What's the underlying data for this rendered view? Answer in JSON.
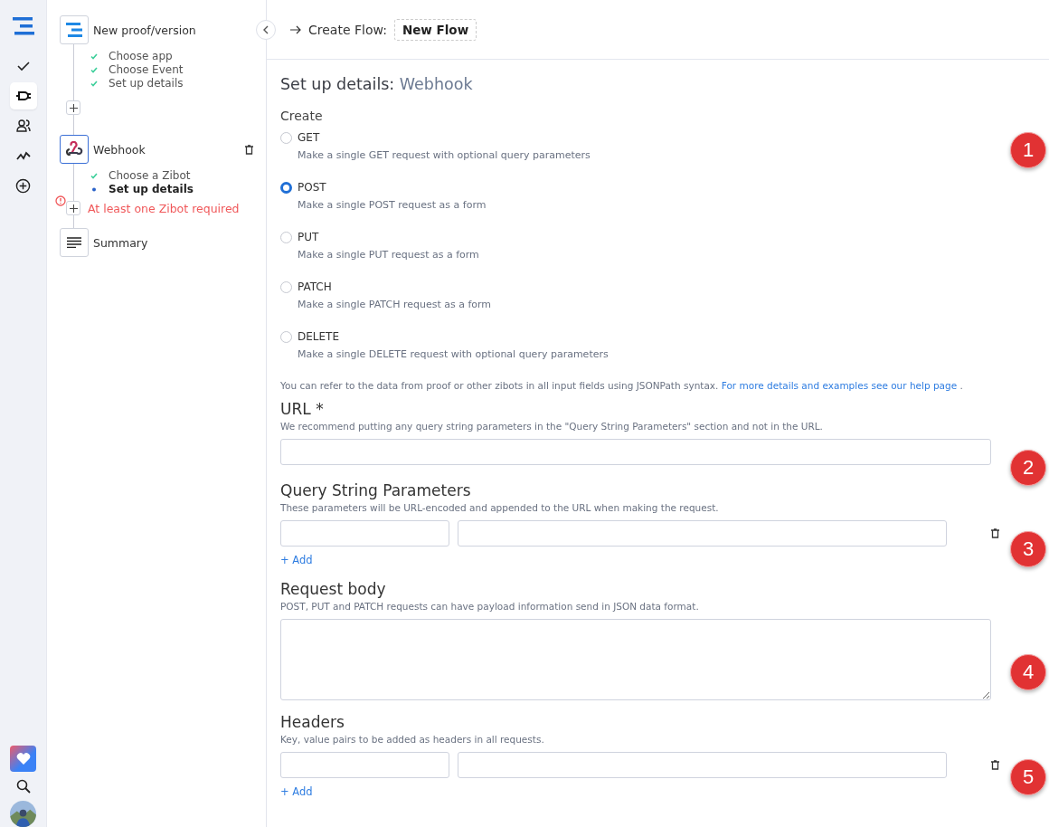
{
  "rail": {
    "items": [
      {
        "selected": false
      },
      {
        "selected": true
      },
      {
        "selected": false
      },
      {
        "selected": false
      },
      {
        "selected": false
      }
    ]
  },
  "flow": [
    {
      "kind": "step",
      "title": "New proof/version",
      "selected": false,
      "substeps": [
        {
          "label": "Choose app",
          "done": true
        },
        {
          "label": "Choose Event",
          "done": true
        },
        {
          "label": "Set up details",
          "done": true
        }
      ]
    },
    {
      "kind": "add"
    },
    {
      "kind": "step",
      "title": "Webhook",
      "selected": true,
      "deletable": true,
      "substeps": [
        {
          "label": "Choose a Zibot",
          "done": true
        },
        {
          "label": "Set up details",
          "done": false
        }
      ]
    },
    {
      "kind": "add",
      "error": "At least one Zibot required"
    },
    {
      "kind": "step",
      "title": "Summary",
      "selected": false
    }
  ],
  "header": {
    "label": "Create Flow:",
    "flow_name": "New Flow"
  },
  "form": {
    "title": "Set up details:",
    "subject": "Webhook",
    "create_label": "Create",
    "methods": [
      {
        "name": "GET",
        "description": "Make a single GET request with optional query parameters",
        "selected": false
      },
      {
        "name": "POST",
        "description": "Make a single POST request as a form",
        "selected": true
      },
      {
        "name": "PUT",
        "description": "Make a single PUT request as a form",
        "selected": false
      },
      {
        "name": "PATCH",
        "description": "Make a single PATCH request as a form",
        "selected": false
      },
      {
        "name": "DELETE",
        "description": "Make a single DELETE request with optional query parameters",
        "selected": false
      }
    ],
    "note": {
      "text": "You can refer to the data from proof or other zibots in all input fields using JSONPath syntax.",
      "link": "For more details and examples see our help page",
      "end": "."
    },
    "sections": [
      {
        "kind": "single",
        "label": "URL *",
        "hint": "We recommend putting any query string parameters in the \"Query String Parameters\" section and not in the URL."
      },
      {
        "kind": "pairs",
        "label": "Query String Parameters",
        "hint": "These parameters will be URL-encoded and appended to the URL when making the request.",
        "add": "+ Add"
      },
      {
        "kind": "multiline",
        "label": "Request body",
        "hint": "POST, PUT and PATCH requests can have payload information send in JSON data format."
      },
      {
        "kind": "pairs",
        "label": "Headers",
        "hint": "Key, value pairs to be added as headers in all requests.",
        "add": "+ Add"
      }
    ]
  },
  "callouts": [
    "1",
    "2",
    "3",
    "4",
    "5"
  ]
}
